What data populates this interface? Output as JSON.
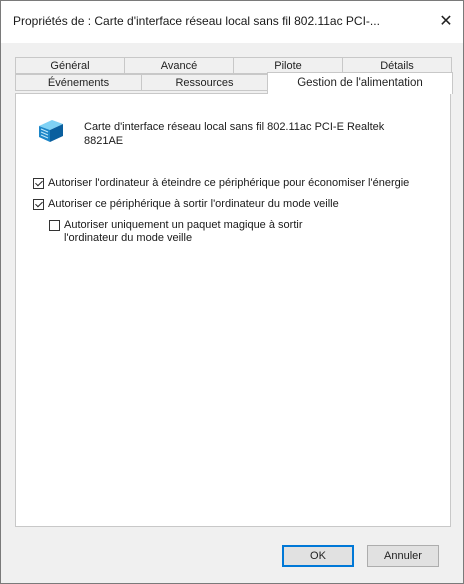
{
  "window": {
    "title": "Propriétés de : Carte d'interface réseau local sans fil 802.11ac PCI-...",
    "close_glyph": "✕"
  },
  "tabs": {
    "row1": [
      "Général",
      "Avancé",
      "Pilote",
      "Détails"
    ],
    "row2": [
      "Événements",
      "Ressources",
      "Gestion de l'alimentation"
    ],
    "active": "Gestion de l'alimentation"
  },
  "device": {
    "icon": "network-adapter-icon",
    "name": "Carte d'interface réseau local sans fil 802.11ac PCI-E Realtek 8821AE"
  },
  "options": [
    {
      "label": "Autoriser l'ordinateur à éteindre ce périphérique pour économiser l'énergie",
      "checked": true
    },
    {
      "label": "Autoriser ce périphérique à sortir l'ordinateur du mode veille",
      "checked": true
    },
    {
      "label": "Autoriser uniquement un paquet magique à sortir l'ordinateur du mode veille",
      "checked": false
    }
  ],
  "buttons": {
    "ok": "OK",
    "cancel": "Annuler"
  }
}
